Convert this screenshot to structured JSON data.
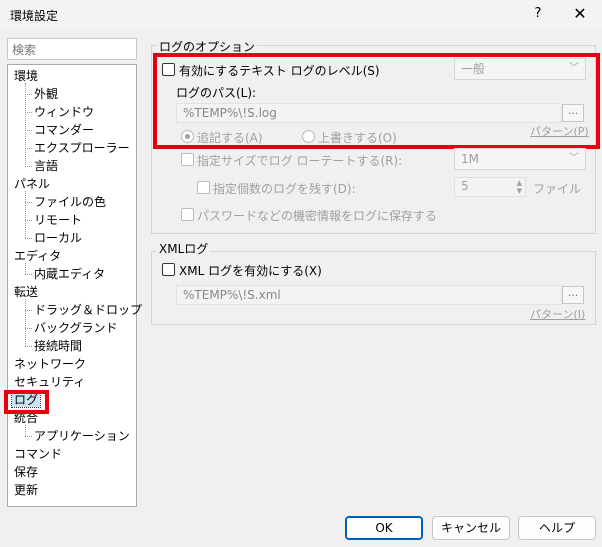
{
  "window": {
    "title": "環境設定",
    "help": "?",
    "close": "✕"
  },
  "search": {
    "placeholder": "検索"
  },
  "tree": {
    "items": [
      {
        "label": "環境"
      },
      {
        "label": "外観"
      },
      {
        "label": "ウィンドウ"
      },
      {
        "label": "コマンダー"
      },
      {
        "label": "エクスプローラー"
      },
      {
        "label": "言語"
      },
      {
        "label": "パネル"
      },
      {
        "label": "ファイルの色"
      },
      {
        "label": "リモート"
      },
      {
        "label": "ローカル"
      },
      {
        "label": "エディタ"
      },
      {
        "label": "内蔵エディタ"
      },
      {
        "label": "転送"
      },
      {
        "label": "ドラッグ＆ドロップ"
      },
      {
        "label": "バックグランド"
      },
      {
        "label": "接続時間"
      },
      {
        "label": "ネットワーク"
      },
      {
        "label": "セキュリティ"
      },
      {
        "label": "ログ"
      },
      {
        "label": "統合"
      },
      {
        "label": "アプリケーション"
      },
      {
        "label": "コマンド"
      },
      {
        "label": "保存"
      },
      {
        "label": "更新"
      }
    ],
    "selected": "ログ"
  },
  "log_options": {
    "group_title": "ログのオプション",
    "enable_text_log_label": "有効にするテキスト ログのレベル(S)",
    "level_value": "一般",
    "path_label": "ログのパス(L):",
    "path_value": "%TEMP%\\!S.log",
    "browse_label": "...",
    "append_label": "追記する(A)",
    "overwrite_label": "上書きする(O)",
    "pattern_label": "パターン(P)",
    "rotate_label": "指定サイズでログ ローテートする(R):",
    "rotate_size": "1M",
    "keep_label": "指定個数のログを残す(D):",
    "keep_count": "5",
    "keep_unit": "ファイル",
    "sensitive_label": "パスワードなどの機密情報をログに保存する"
  },
  "xml_log": {
    "group_title": "XMLログ",
    "enable_label": "XML ログを有効にする(X)",
    "path_value": "%TEMP%\\!S.xml",
    "browse_label": "...",
    "pattern_label": "パターン(I)"
  },
  "buttons": {
    "ok": "OK",
    "cancel": "キャンセル",
    "help": "ヘルプ"
  },
  "colors": {
    "highlight": "#e60012",
    "primary_border": "#005fb8"
  }
}
